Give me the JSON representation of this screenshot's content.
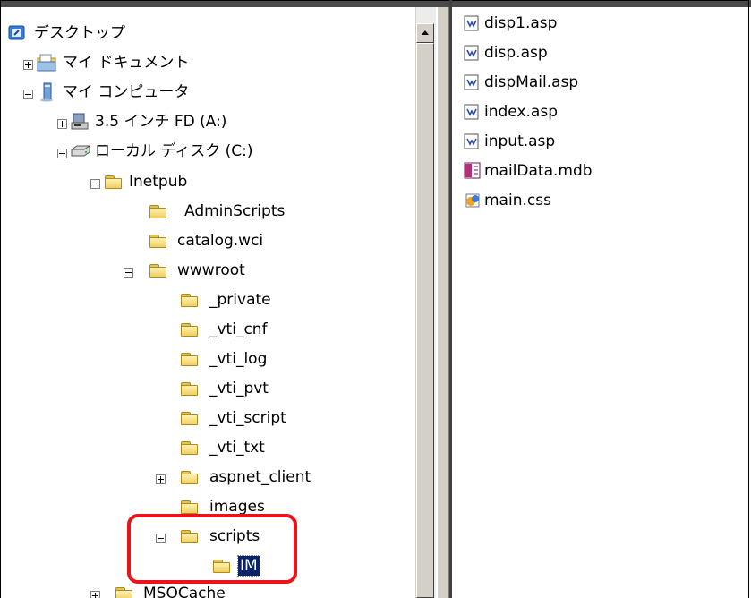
{
  "tree": {
    "desktop": "デスクトップ",
    "my_documents": "マイ ドキュメント",
    "my_computer": "マイ コンピュータ",
    "floppy": "3.5 インチ FD (A:)",
    "local_disk": "ローカル ディスク (C:)",
    "inetpub": "Inetpub",
    "admin_scripts": "AdminScripts",
    "catalog_wci": "catalog.wci",
    "wwwroot": "wwwroot",
    "private": "_private",
    "vti_cnf": "_vti_cnf",
    "vti_log": "_vti_log",
    "vti_pvt": "_vti_pvt",
    "vti_script": "_vti_script",
    "vti_txt": "_vti_txt",
    "aspnet_client": "aspnet_client",
    "images": "images",
    "scripts": "scripts",
    "im": "IM",
    "msocache": "MSOCache"
  },
  "files": [
    {
      "name": "disp1.asp",
      "icon": "asp-file-icon"
    },
    {
      "name": "disp.asp",
      "icon": "asp-file-icon"
    },
    {
      "name": "dispMail.asp",
      "icon": "asp-file-icon"
    },
    {
      "name": "index.asp",
      "icon": "asp-file-icon"
    },
    {
      "name": "input.asp",
      "icon": "asp-file-icon"
    },
    {
      "name": "mailData.mdb",
      "icon": "access-db-icon"
    },
    {
      "name": "main.css",
      "icon": "css-file-icon"
    }
  ],
  "colors": {
    "selection": "#0a246a",
    "highlight_box": "#e8131b",
    "folder": "#f0cf63"
  }
}
